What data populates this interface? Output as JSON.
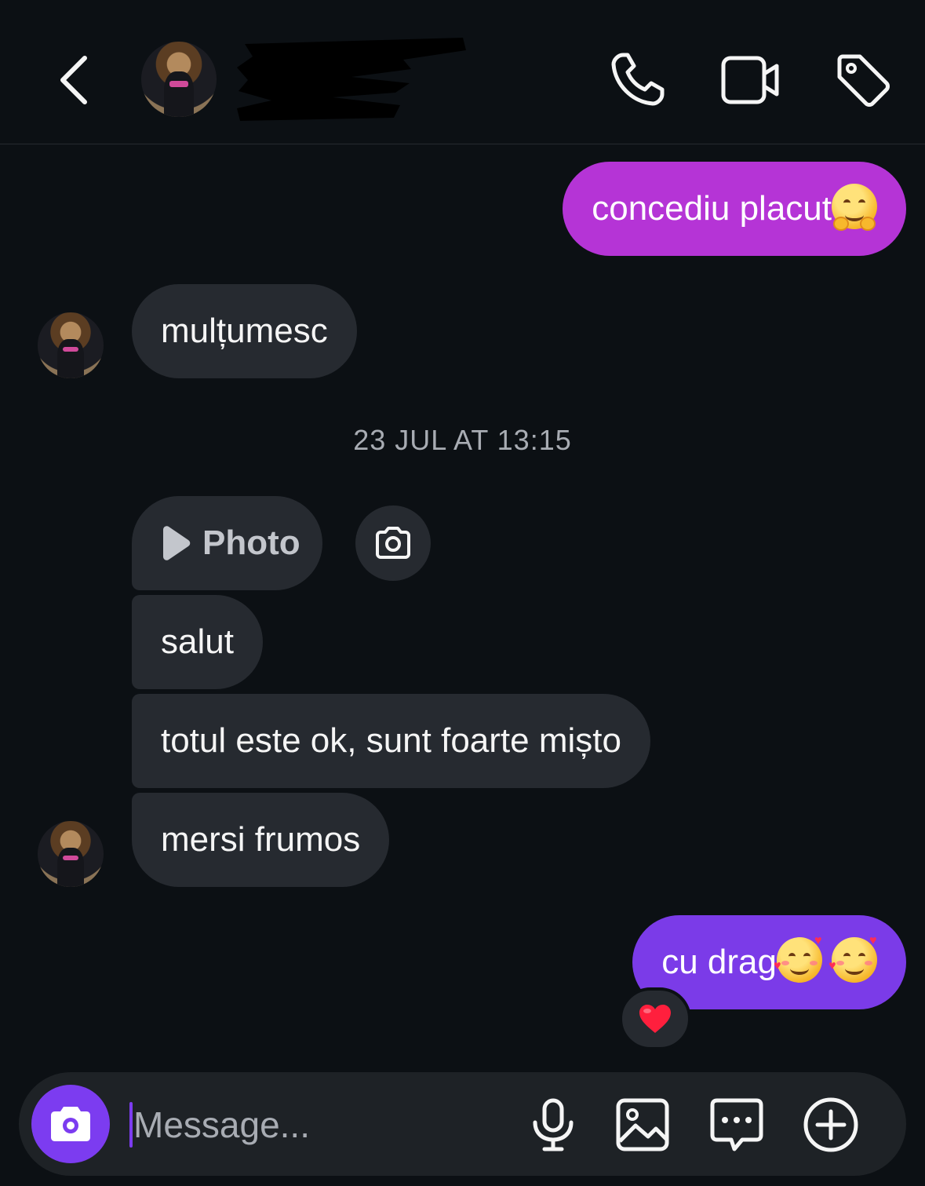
{
  "header": {
    "back_icon": "chevron-left-icon",
    "call_icon": "phone-icon",
    "video_icon": "video-camera-icon",
    "tag_icon": "tag-icon"
  },
  "messages": {
    "sent_1": {
      "text": "concediu placut",
      "emoji": "hugging-face-emoji"
    },
    "recv_1": "mulțumesc",
    "timestamp": "23 JUL AT 13:15",
    "photo_label": "Photo",
    "recv_2": "salut",
    "recv_3": "totul este ok, sunt foarte mișto",
    "recv_4": "mersi frumos",
    "sent_2": {
      "text": "cu drag",
      "emoji": "smiling-face-with-hearts-emoji"
    },
    "reaction": "red-heart-emoji"
  },
  "composer": {
    "placeholder": "Message..."
  },
  "colors": {
    "background": "#0c1014",
    "sent_bubble_1": "#b534d6",
    "sent_bubble_2": "#7b3be8",
    "received_bubble": "#262a30",
    "accent": "#7c3cf0"
  }
}
